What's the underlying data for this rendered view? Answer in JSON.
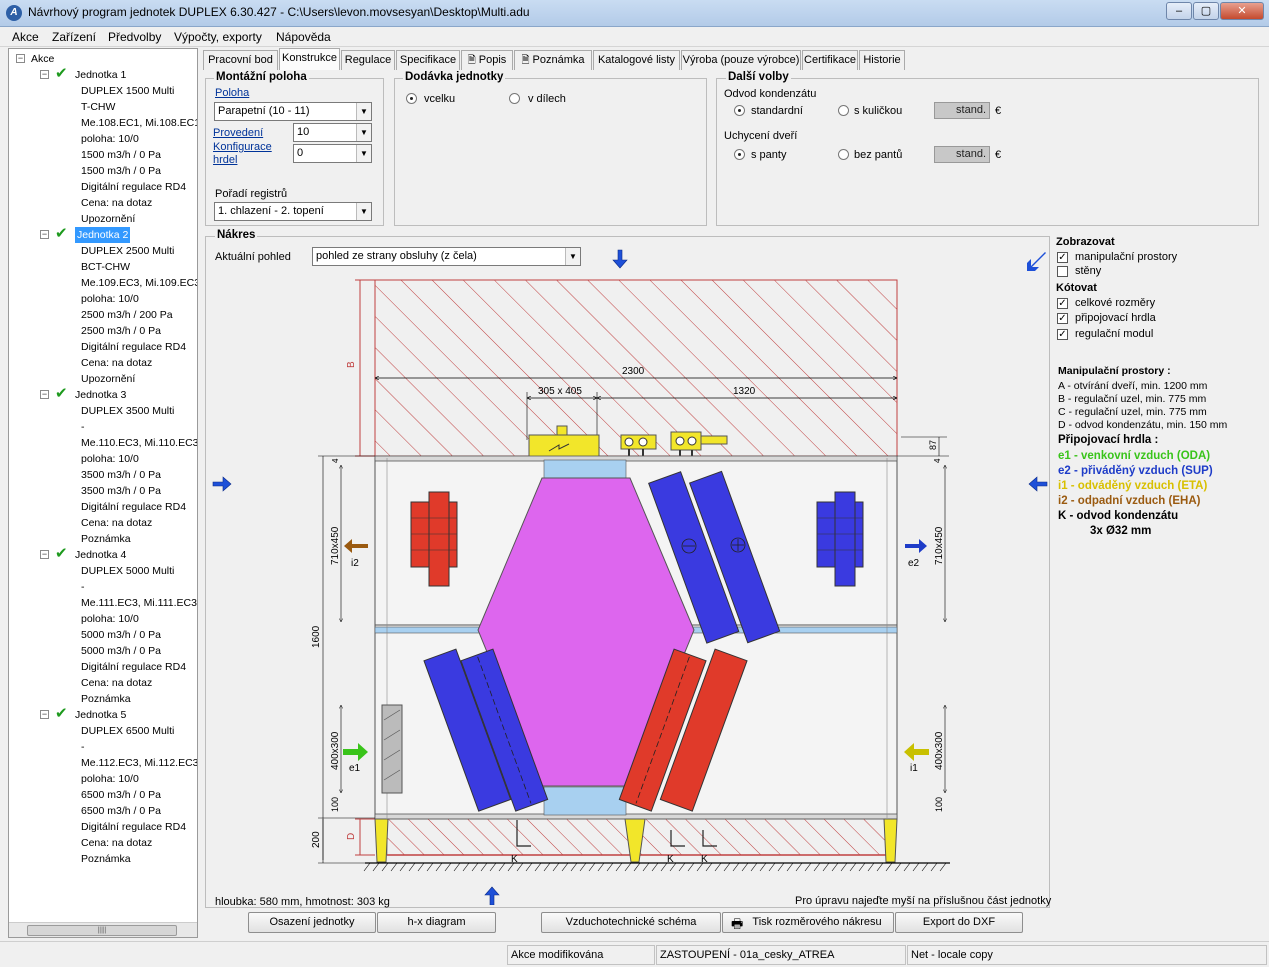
{
  "window": {
    "title": "Návrhový program jednotek DUPLEX 6.30.427 - C:\\Users\\levon.movsesyan\\Desktop\\Multi.adu",
    "icon_letter": "A",
    "btn_min": "–",
    "btn_max": "▢",
    "btn_close": "✕"
  },
  "menu": [
    "Akce",
    "Zařízení",
    "Předvolby",
    "Výpočty, exporty",
    "Nápověda"
  ],
  "tree": {
    "root": "Akce",
    "units": [
      {
        "label": "Jednotka 1",
        "selected": false,
        "items": [
          "DUPLEX 1500 Multi",
          "T-CHW",
          "Me.108.EC1, Mi.108.EC1",
          "poloha: 10/0",
          "1500 m3/h / 0 Pa",
          "1500 m3/h / 0 Pa",
          "Digitální regulace RD4",
          "Cena: na dotaz",
          "Upozornění"
        ]
      },
      {
        "label": "Jednotka 2",
        "selected": true,
        "items": [
          "DUPLEX 2500 Multi",
          "BCT-CHW",
          "Me.109.EC3, Mi.109.EC3",
          "poloha: 10/0",
          "2500 m3/h / 200 Pa",
          "2500 m3/h / 0 Pa",
          "Digitální regulace RD4",
          "Cena: na dotaz",
          "Upozornění"
        ]
      },
      {
        "label": "Jednotka 3",
        "selected": false,
        "items": [
          "DUPLEX 3500 Multi",
          "-",
          "Me.110.EC3, Mi.110.EC3",
          "poloha: 10/0",
          "3500 m3/h / 0 Pa",
          "3500 m3/h / 0 Pa",
          "Digitální regulace RD4",
          "Cena: na dotaz",
          "Poznámka"
        ]
      },
      {
        "label": "Jednotka 4",
        "selected": false,
        "items": [
          "DUPLEX 5000 Multi",
          "-",
          "Me.111.EC3, Mi.111.EC3",
          "poloha: 10/0",
          "5000 m3/h / 0 Pa",
          "5000 m3/h / 0 Pa",
          "Digitální regulace RD4",
          "Cena: na dotaz",
          "Poznámka"
        ]
      },
      {
        "label": "Jednotka 5",
        "selected": false,
        "items": [
          "DUPLEX 6500 Multi",
          "-",
          "Me.112.EC3, Mi.112.EC3",
          "poloha: 10/0",
          "6500 m3/h / 0 Pa",
          "6500 m3/h / 0 Pa",
          "Digitální regulace RD4",
          "Cena: na dotaz",
          "Poznámka"
        ]
      }
    ],
    "scroll_grip": "|||||"
  },
  "tabs": [
    {
      "label": "Pracovní bod",
      "active": false,
      "icon": ""
    },
    {
      "label": "Konstrukce",
      "active": true,
      "icon": ""
    },
    {
      "label": "Regulace",
      "active": false,
      "icon": ""
    },
    {
      "label": "Specifikace",
      "active": false,
      "icon": ""
    },
    {
      "label": "Popis",
      "active": false,
      "icon": "document-icon"
    },
    {
      "label": "Poznámka",
      "active": false,
      "icon": "document-icon"
    },
    {
      "label": "Katalogové listy",
      "active": false,
      "icon": ""
    },
    {
      "label": "Výroba (pouze výrobce)",
      "active": false,
      "icon": ""
    },
    {
      "label": "Certifikace",
      "active": false,
      "icon": ""
    },
    {
      "label": "Historie",
      "active": false,
      "icon": ""
    }
  ],
  "montazni": {
    "title": "Montážní poloha",
    "poloha_label": "Poloha",
    "poloha_value": "Parapetní   (10 - 11)",
    "provedeni_label": "Provedení",
    "provedeni_value": "10",
    "konfig_label1": "Konfigurace",
    "konfig_label2": "hrdel",
    "konfig_value": "0",
    "poradi_label": "Pořadí registrů",
    "poradi_value": "1. chlazení - 2. topení"
  },
  "dodavka": {
    "title": "Dodávka jednotky",
    "opt1": "vcelku",
    "opt2": "v dílech"
  },
  "dalsi": {
    "title": "Další volby",
    "odvod_label": "Odvod kondenzátu",
    "odvod_opt1": "standardní",
    "odvod_opt2": "s kuličkou",
    "odvod_box": "stand.",
    "currency1": "€",
    "uchyceni_label": "Uchycení dveří",
    "uchyceni_opt1": "s panty",
    "uchyceni_opt2": "bez pantů",
    "uchyceni_box": "stand.",
    "currency2": "€"
  },
  "nakres": {
    "title": "Nákres",
    "view_label": "Aktuální pohled",
    "view_value": "pohled ze strany obsluhy (z čela)",
    "bottom_left": "hloubka: 580 mm, hmotnost: 303 kg",
    "bottom_right": "Pro úpravu najeďte myší na příslušnou část jednotky"
  },
  "drawing": {
    "dim_total": "2300",
    "dim_conn": "305 x 405",
    "dim_1320": "1320",
    "dim_87": "87",
    "dim_1600": "1600",
    "dim_200": "200",
    "dim_100a": "100",
    "dim_100b": "100",
    "dim_710l": "710x450",
    "dim_710r": "710x450",
    "dim_400l": "400x300",
    "dim_400r": "400x300",
    "dim_4a": "4",
    "dim_4b": "4",
    "zone_b": "B",
    "zone_d": "D",
    "lbl_i2": "i2",
    "lbl_e2": "e2",
    "lbl_e1": "e1",
    "lbl_i1": "i1",
    "lbl_k1": "K",
    "lbl_k2": "K",
    "lbl_k3": "K"
  },
  "side": {
    "zobrazovat": "Zobrazovat",
    "cb1": "manipulační prostory",
    "cb2": "stěny",
    "kotovat": "Kótovat",
    "cb3": "celkové rozměry",
    "cb4": "připojovací hrdla",
    "cb5": "regulační modul",
    "manip_title": "Manipulační prostory :",
    "manip": [
      "A - otvírání dveří, min. 1200 mm",
      "B - regulační uzel, min. 775 mm",
      "C - regulační uzel, min. 775 mm",
      "D - odvod kondenzátu, min. 150 mm"
    ],
    "prip_title": "Připojovací hrdla :",
    "prip": [
      {
        "text": "e1 - venkovní vzduch (ODA)",
        "color": "#39c41a"
      },
      {
        "text": "e2 - přiváděný vzduch (SUP)",
        "color": "#1e3cc8"
      },
      {
        "text": "i1 - odváděný vzduch (ETA)",
        "color": "#d8c000"
      },
      {
        "text": "i2 - odpadní vzduch (EHA)",
        "color": "#9a5a10"
      }
    ],
    "kond_line": "K  - odvod kondenzátu",
    "kond_size": "3x Ø32 mm"
  },
  "buttons": {
    "osazeni": "Osazení jednotky",
    "hx": "h-x diagram",
    "vzt": "Vzduchotechnické schéma",
    "tisk": "Tisk rozměrového nákresu",
    "dxf": "Export do DXF"
  },
  "status": {
    "s1": "Akce modifikována",
    "s2": "ZASTOUPENÍ - 01a_cesky_ATREA",
    "s3": "Net - locale copy"
  },
  "colors": {
    "purple_hx": "#dd66ee",
    "red_coil": "#e03a2a",
    "blue_coil": "#3a3ae0",
    "hatch": "#c03030"
  }
}
